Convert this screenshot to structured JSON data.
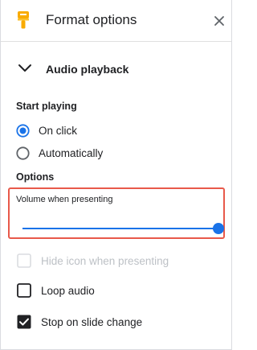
{
  "header": {
    "title": "Format options",
    "brush_icon_color": "#f9ab00"
  },
  "section": {
    "label": "Audio playback",
    "expanded": true
  },
  "start_playing": {
    "label": "Start playing",
    "options": [
      {
        "label": "On click",
        "selected": true
      },
      {
        "label": "Automatically",
        "selected": false
      }
    ]
  },
  "options": {
    "label": "Options",
    "volume": {
      "label": "Volume when presenting",
      "level_percent": 100
    },
    "checkboxes": [
      {
        "label": "Hide icon when presenting",
        "checked": false,
        "disabled": true
      },
      {
        "label": "Loop audio",
        "checked": false,
        "disabled": false
      },
      {
        "label": "Stop on slide change",
        "checked": true,
        "disabled": false
      }
    ]
  },
  "colors": {
    "accent": "#1a73e8",
    "highlight_border": "#e8594a",
    "disabled_text": "#bdc1c6"
  }
}
